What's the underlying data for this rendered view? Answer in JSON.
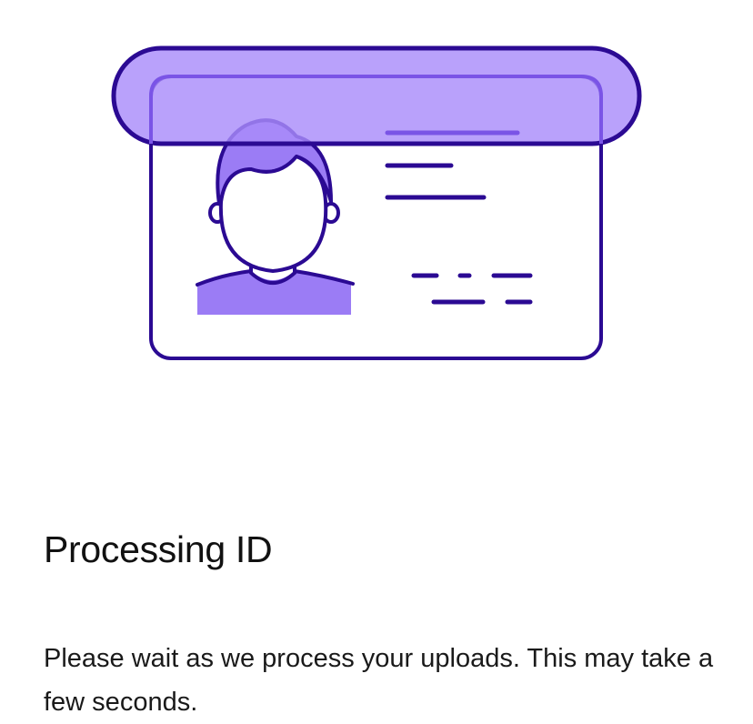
{
  "screen": {
    "title": "Processing ID",
    "description": "Please wait as we process your uploads. This may take a few seconds."
  },
  "illustration": {
    "icon": "id-card-scan-icon",
    "colors": {
      "outline": "#2b0a93",
      "accent": "#9b7cf5",
      "accent_translucent": "#b19bfb",
      "background": "#ffffff"
    }
  }
}
